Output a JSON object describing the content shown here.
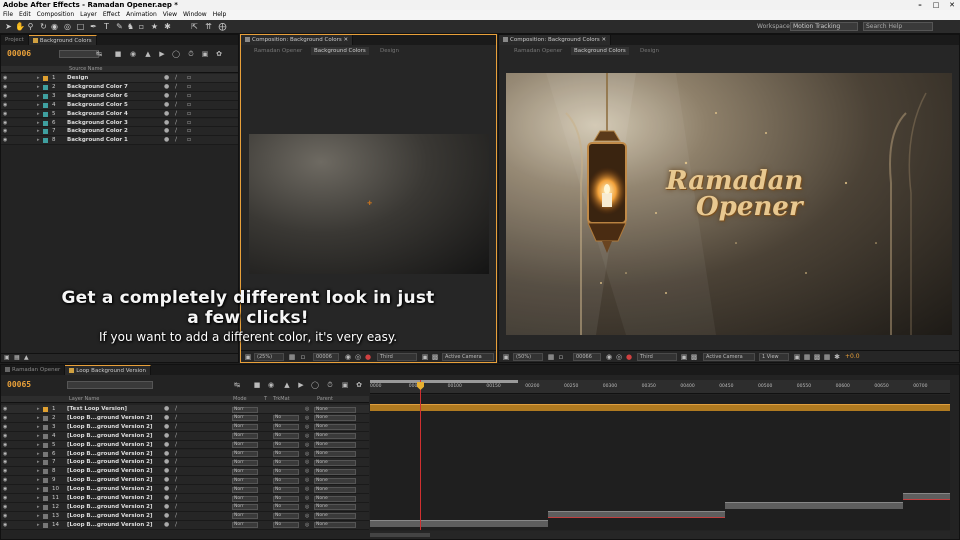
{
  "app": {
    "title": "Adobe After Effects - Ramadan Opener.aep *",
    "menu": [
      "File",
      "Edit",
      "Composition",
      "Layer",
      "Effect",
      "Animation",
      "View",
      "Window",
      "Help"
    ],
    "workspace_label": "Workspace:",
    "workspace_value": "Motion Tracking",
    "search_placeholder": "Search Help"
  },
  "project_panel": {
    "tabs": [
      "Project",
      "Background Colors"
    ],
    "timecode": "00006",
    "col_source_name": "Source Name",
    "layers": [
      {
        "num": "1",
        "name": "Design",
        "color": "#e0a030"
      },
      {
        "num": "2",
        "name": "Background Color 7",
        "color": "#3fa0a0"
      },
      {
        "num": "3",
        "name": "Background Color 6",
        "color": "#3fa0a0"
      },
      {
        "num": "4",
        "name": "Background Color 5",
        "color": "#3fa0a0"
      },
      {
        "num": "5",
        "name": "Background Color 4",
        "color": "#3fa0a0"
      },
      {
        "num": "6",
        "name": "Background Color 3",
        "color": "#3fa0a0"
      },
      {
        "num": "7",
        "name": "Background Color 2",
        "color": "#3fa0a0"
      },
      {
        "num": "8",
        "name": "Background Color 1",
        "color": "#3fa0a0"
      }
    ]
  },
  "comp_middle": {
    "tab": "Composition: Background Colors",
    "subtabs": [
      "Ramadan Opener",
      "Background Colors",
      "Design"
    ],
    "zoom": "(25%)",
    "timecode": "00006",
    "resolution": "Third",
    "camera": "Active Camera"
  },
  "comp_right": {
    "tab": "Composition: Background Colors",
    "subtabs": [
      "Ramadan Opener",
      "Background Colors",
      "Design"
    ],
    "zoom": "(50%)",
    "timecode": "00066",
    "resolution": "Third",
    "camera": "Active Camera",
    "views": "1 View",
    "exposure": "+0.0",
    "title_line1": "Ramadan",
    "title_line2": "Opener"
  },
  "caption": {
    "line1": "Get a completely different look in just a few clicks!",
    "line2": "If you want to add a different color, it's very easy."
  },
  "timeline": {
    "tabs": [
      "Ramadan Opener",
      "Loop Background Version"
    ],
    "timecode": "00065",
    "col_layer_name": "Layer Name",
    "col_mode": "Mode",
    "col_t": "T",
    "col_trkmat": "TrkMat",
    "col_parent": "Parent",
    "ruler": [
      "0000",
      "00050",
      "00100",
      "00150",
      "00200",
      "00250",
      "00300",
      "00350",
      "00400",
      "00450",
      "00500",
      "00550",
      "00600",
      "00650",
      "00700"
    ],
    "layers": [
      {
        "num": "1",
        "name": "[Text Loop Version]",
        "mode": "Norr",
        "trk": "",
        "parent": "None"
      },
      {
        "num": "2",
        "name": "[Loop B...ground Version 2]",
        "mode": "Norr",
        "trk": "No",
        "parent": "None"
      },
      {
        "num": "3",
        "name": "[Loop B...ground Version 2]",
        "mode": "Norr",
        "trk": "No",
        "parent": "None"
      },
      {
        "num": "4",
        "name": "[Loop B...ground Version 2]",
        "mode": "Norr",
        "trk": "No",
        "parent": "None"
      },
      {
        "num": "5",
        "name": "[Loop B...ground Version 2]",
        "mode": "Norr",
        "trk": "No",
        "parent": "None"
      },
      {
        "num": "6",
        "name": "[Loop B...ground Version 2]",
        "mode": "Norr",
        "trk": "No",
        "parent": "None"
      },
      {
        "num": "7",
        "name": "[Loop B...ground Version 2]",
        "mode": "Norr",
        "trk": "No",
        "parent": "None"
      },
      {
        "num": "8",
        "name": "[Loop B...ground Version 2]",
        "mode": "Norr",
        "trk": "No",
        "parent": "None"
      },
      {
        "num": "9",
        "name": "[Loop B...ground Version 2]",
        "mode": "Norr",
        "trk": "No",
        "parent": "None"
      },
      {
        "num": "10",
        "name": "[Loop B...ground Version 2]",
        "mode": "Norr",
        "trk": "No",
        "parent": "None"
      },
      {
        "num": "11",
        "name": "[Loop B...ground Version 2]",
        "mode": "Norr",
        "trk": "No",
        "parent": "None"
      },
      {
        "num": "12",
        "name": "[Loop B...ground Version 2]",
        "mode": "Norr",
        "trk": "No",
        "parent": "None"
      },
      {
        "num": "13",
        "name": "[Loop B...ground Version 2]",
        "mode": "Norr",
        "trk": "No",
        "parent": "None"
      },
      {
        "num": "14",
        "name": "[Loop B...ground Version 2]",
        "mode": "Norr",
        "trk": "No",
        "parent": "None"
      }
    ]
  },
  "colors": {
    "accent": "#e8a03a",
    "playhead": "#d03030",
    "bar_orange": "#b07a20"
  }
}
